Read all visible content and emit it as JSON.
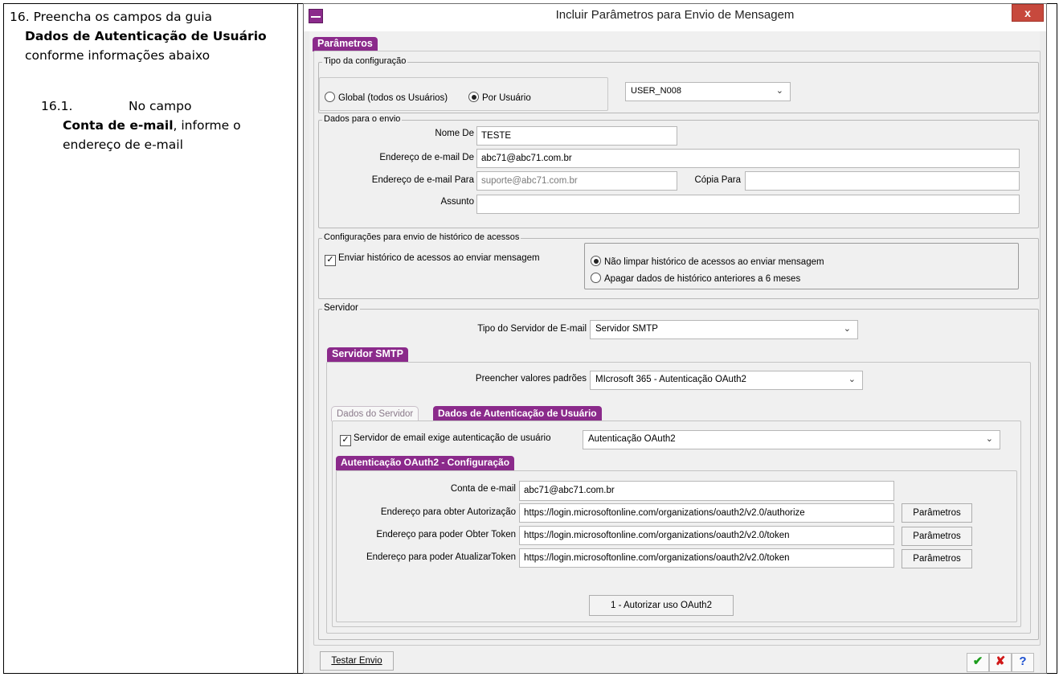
{
  "instructions": {
    "step_number": "16.",
    "step_text_before": "Preencha os campos da guia ",
    "step_bold": "Dados de Autenticação de Usuário",
    "step_text_after": " conforme informações abaixo",
    "substep_number": "16.1.",
    "substep_before": "No campo ",
    "substep_bold": "Conta de e-mail",
    "substep_after": ", informe o endereço de e-mail"
  },
  "window": {
    "title": "Incluir Parâmetros para Envio de Mensagem",
    "close_label": "x",
    "main_tab": "Parâmetros"
  },
  "tipo_config": {
    "legend": "Tipo da configuração",
    "option_global": "Global (todos os Usuários)",
    "option_usuario": "Por Usuário",
    "selected": "Por Usuário",
    "user_select": "USER_N008"
  },
  "dados_envio": {
    "legend": "Dados para o envio",
    "nome_de_label": "Nome De",
    "nome_de_value": "TESTE",
    "email_de_label": "Endereço de e-mail De",
    "email_de_value": "abc71@abc71.com.br",
    "email_para_label": "Endereço de e-mail Para",
    "email_para_value": "suporte@abc71.com.br",
    "copia_label": "Cópia Para",
    "copia_value": "",
    "assunto_label": "Assunto",
    "assunto_value": ""
  },
  "historico": {
    "legend": "Configurações para envio de histórico de acessos",
    "enviar_label": "Enviar histórico de acessos ao enviar mensagem",
    "enviar_checked": true,
    "option_nao_limpar": "Não limpar histórico de acessos ao enviar mensagem",
    "option_apagar": "Apagar dados de histórico anteriores a 6 meses",
    "selected": "Não limpar histórico de acessos ao enviar mensagem"
  },
  "servidor": {
    "legend": "Servidor",
    "tipo_label": "Tipo do Servidor de E-mail",
    "tipo_value": "Servidor SMTP",
    "smtp_tab": "Servidor SMTP",
    "preencher_label": "Preencher valores padrões",
    "preencher_value": "MIcrosoft 365 - Autenticação OAuth2",
    "tabs": [
      "Dados do Servidor",
      "Dados de Autenticação de Usuário"
    ],
    "active_tab": "Dados de Autenticação de Usuário",
    "exige_auth_label": "Servidor de email exige autenticação de usuário",
    "exige_auth_checked": true,
    "auth_type_value": "Autenticação OAuth2",
    "oauth_tab": "Autenticação OAuth2 - Configuração"
  },
  "oauth": {
    "conta_label": "Conta de e-mail",
    "conta_value": "abc71@abc71.com.br",
    "autorizacao_label": "Endereço para obter Autorização",
    "autorizacao_value": "https://login.microsoftonline.com/organizations/oauth2/v2.0/authorize",
    "obter_token_label": "Endereço para poder Obter Token",
    "obter_token_value": "https://login.microsoftonline.com/organizations/oauth2/v2.0/token",
    "atualizar_token_label": "Endereço para poder AtualizarToken",
    "atualizar_token_value": "https://login.microsoftonline.com/organizations/oauth2/v2.0/token",
    "parametros_label": "Parâmetros",
    "autorizar_button": "1 - Autorizar uso OAuth2"
  },
  "footer": {
    "testar_envio": "Testar Envio",
    "ok_icon": "check-icon",
    "cancel_icon": "x-icon",
    "help_icon": "help-icon",
    "colors": {
      "ok": "#1e9e1e",
      "cancel": "#d01818",
      "help": "#1b4fd0"
    }
  },
  "colors": {
    "accent": "#8b2a8b"
  }
}
